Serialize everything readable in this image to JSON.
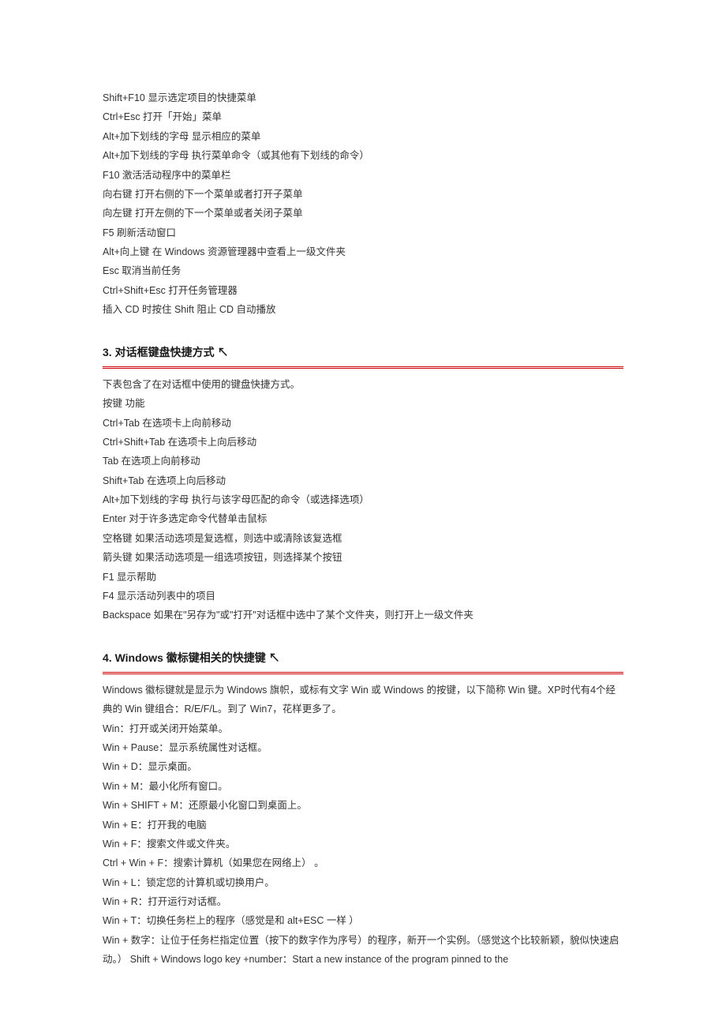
{
  "section_top_lines": [
    "Shift+F10 显示选定项目的快捷菜单",
    "Ctrl+Esc 打开「开始」菜单",
    "Alt+加下划线的字母 显示相应的菜单",
    "Alt+加下划线的字母 执行菜单命令（或其他有下划线的命令）",
    "F10 激活活动程序中的菜单栏",
    "向右键 打开右侧的下一个菜单或者打开子菜单",
    "向左键 打开左侧的下一个菜单或者关闭子菜单",
    "F5 刷新活动窗口",
    "Alt+向上键 在 Windows 资源管理器中查看上一级文件夹",
    "Esc 取消当前任务",
    "Ctrl+Shift+Esc 打开任务管理器",
    "插入 CD 时按住 Shift 阻止 CD 自动播放"
  ],
  "heading3": "3. 对话框键盘快捷方式 ↖",
  "section3_lines": [
    "下表包含了在对话框中使用的键盘快捷方式。",
    "按键 功能",
    "Ctrl+Tab 在选项卡上向前移动",
    "Ctrl+Shift+Tab 在选项卡上向后移动",
    "Tab 在选项上向前移动",
    "Shift+Tab 在选项上向后移动",
    "Alt+加下划线的字母 执行与该字母匹配的命令（或选择选项）",
    "Enter 对于许多选定命令代替单击鼠标",
    "空格键 如果活动选项是复选框，则选中或清除该复选框",
    "箭头键 如果活动选项是一组选项按钮，则选择某个按钮",
    "F1 显示帮助",
    "F4 显示活动列表中的项目",
    "Backspace 如果在\"另存为\"或\"打开\"对话框中选中了某个文件夹，则打开上一级文件夹"
  ],
  "heading4": "4. Windows 徽标键相关的快捷键 ↖",
  "section4_lines": [
    "Windows 徽标键就是显示为 Windows 旗帜，或标有文字 Win 或 Windows 的按键，以下简称 Win 键。XP时代有4个经典的 Win 键组合：R/E/F/L。到了 Win7，花样更多了。",
    "Win：打开或关闭开始菜单。",
    "Win + Pause：显示系统属性对话框。",
    "Win + D：显示桌面。",
    "Win + M：最小化所有窗口。",
    "Win + SHIFT + M：还原最小化窗口到桌面上。",
    "Win + E：打开我的电脑",
    "Win + F：搜索文件或文件夹。",
    "Ctrl + Win + F：搜索计算机（如果您在网络上） 。",
    "Win + L：锁定您的计算机或切换用户。",
    "Win + R：打开运行对话框。",
    "Win + T：切换任务栏上的程序（感觉是和 alt+ESC 一样 ）",
    "Win + 数字：让位于任务栏指定位置（按下的数字作为序号）的程序，新开一个实例。（感觉这个比较新颖，貌似快速启动。）  Shift + Windows logo key +number：Start a new instance of the program pinned to the"
  ]
}
